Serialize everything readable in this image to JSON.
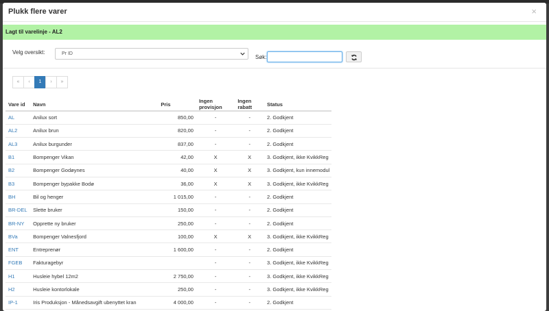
{
  "modal": {
    "title": "Plukk flere varer",
    "close_label": "×"
  },
  "alert": {
    "text": "Lagt til varelinje - AL2"
  },
  "filter": {
    "overview_label": "Velg oversikt:",
    "overview_value": "Pr ID",
    "search_label": "Søk:",
    "search_value": ""
  },
  "pagination": {
    "first": "«",
    "prev": "‹",
    "current": "1",
    "next": "›",
    "last": "»"
  },
  "table": {
    "headers": {
      "id": "Vare id",
      "name": "Navn",
      "price": "Pris",
      "no_commission": "Ingen provisjon",
      "no_discount": "Ingen rabatt",
      "status": "Status"
    },
    "rows": [
      {
        "id": "AL",
        "name": "Anilux sort",
        "price": "850,00",
        "no_commission": "-",
        "no_discount": "-",
        "status": "2. Godkjent"
      },
      {
        "id": "AL2",
        "name": "Anilux brun",
        "price": "820,00",
        "no_commission": "-",
        "no_discount": "-",
        "status": "2. Godkjent"
      },
      {
        "id": "AL3",
        "name": "Anilux burgunder",
        "price": "837,00",
        "no_commission": "-",
        "no_discount": "-",
        "status": "2. Godkjent"
      },
      {
        "id": "B1",
        "name": "Bompenger Vikan",
        "price": "42,00",
        "no_commission": "X",
        "no_discount": "X",
        "status": "3. Godkjent, ikke KvikkReg"
      },
      {
        "id": "B2",
        "name": "Bompenger Godøynes",
        "price": "40,00",
        "no_commission": "X",
        "no_discount": "X",
        "status": "3. Godkjent, kun innemodul"
      },
      {
        "id": "B3",
        "name": "Bompenger bypakke Bodø",
        "price": "36,00",
        "no_commission": "X",
        "no_discount": "X",
        "status": "3. Godkjent, ikke KvikkReg"
      },
      {
        "id": "BH",
        "name": "Bil og henger",
        "price": "1 015,00",
        "no_commission": "-",
        "no_discount": "-",
        "status": "2. Godkjent"
      },
      {
        "id": "BR-DEL",
        "name": "Slette bruker",
        "price": "150,00",
        "no_commission": "-",
        "no_discount": "-",
        "status": "2. Godkjent"
      },
      {
        "id": "BR-NY",
        "name": "Opprette ny bruker",
        "price": "250,00",
        "no_commission": "-",
        "no_discount": "-",
        "status": "2. Godkjent"
      },
      {
        "id": "BVa",
        "name": "Bompenger Valnesfjord",
        "price": "100,00",
        "no_commission": "X",
        "no_discount": "X",
        "status": "3. Godkjent, ikke KvikkReg"
      },
      {
        "id": "ENT",
        "name": "Entreprenør",
        "price": "1 600,00",
        "no_commission": "-",
        "no_discount": "-",
        "status": "2. Godkjent"
      },
      {
        "id": "FGEB",
        "name": "Fakturagebyr",
        "price": "",
        "no_commission": "-",
        "no_discount": "-",
        "status": "3. Godkjent, ikke KvikkReg"
      },
      {
        "id": "H1",
        "name": "Husleie hybel 12m2",
        "price": "2 750,00",
        "no_commission": "-",
        "no_discount": "-",
        "status": "3. Godkjent, ikke KvikkReg"
      },
      {
        "id": "H2",
        "name": "Husleie kontorlokale",
        "price": "250,00",
        "no_commission": "-",
        "no_discount": "-",
        "status": "3. Godkjent, ikke KvikkReg"
      },
      {
        "id": "IP-1",
        "name": "Iris Produksjon - Månedsavgift ubenyttet kran",
        "price": "4 000,00",
        "no_commission": "-",
        "no_discount": "-",
        "status": "2. Godkjent"
      }
    ]
  },
  "colors": {
    "alert_bg": "#b2f2a5",
    "accent": "#337ab7"
  },
  "icons": {
    "refresh": "refresh-icon",
    "dropdown": "chevron-down-icon"
  }
}
